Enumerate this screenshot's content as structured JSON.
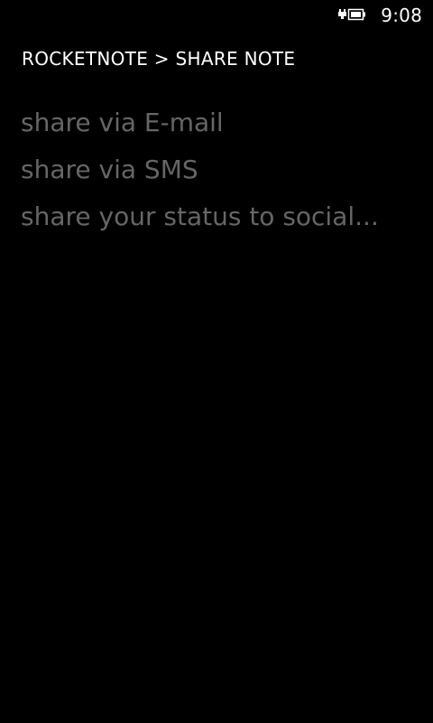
{
  "status_bar": {
    "time": "9:08",
    "battery_icon": "battery-charging-icon"
  },
  "header": {
    "title": "ROCKETNOTE > SHARE NOTE"
  },
  "share_options": [
    {
      "label": "share via E-mail"
    },
    {
      "label": "share via SMS"
    },
    {
      "label": "share your status to social..."
    }
  ],
  "colors": {
    "background": "#000000",
    "header_text": "#ffffff",
    "item_text": "#666666"
  }
}
